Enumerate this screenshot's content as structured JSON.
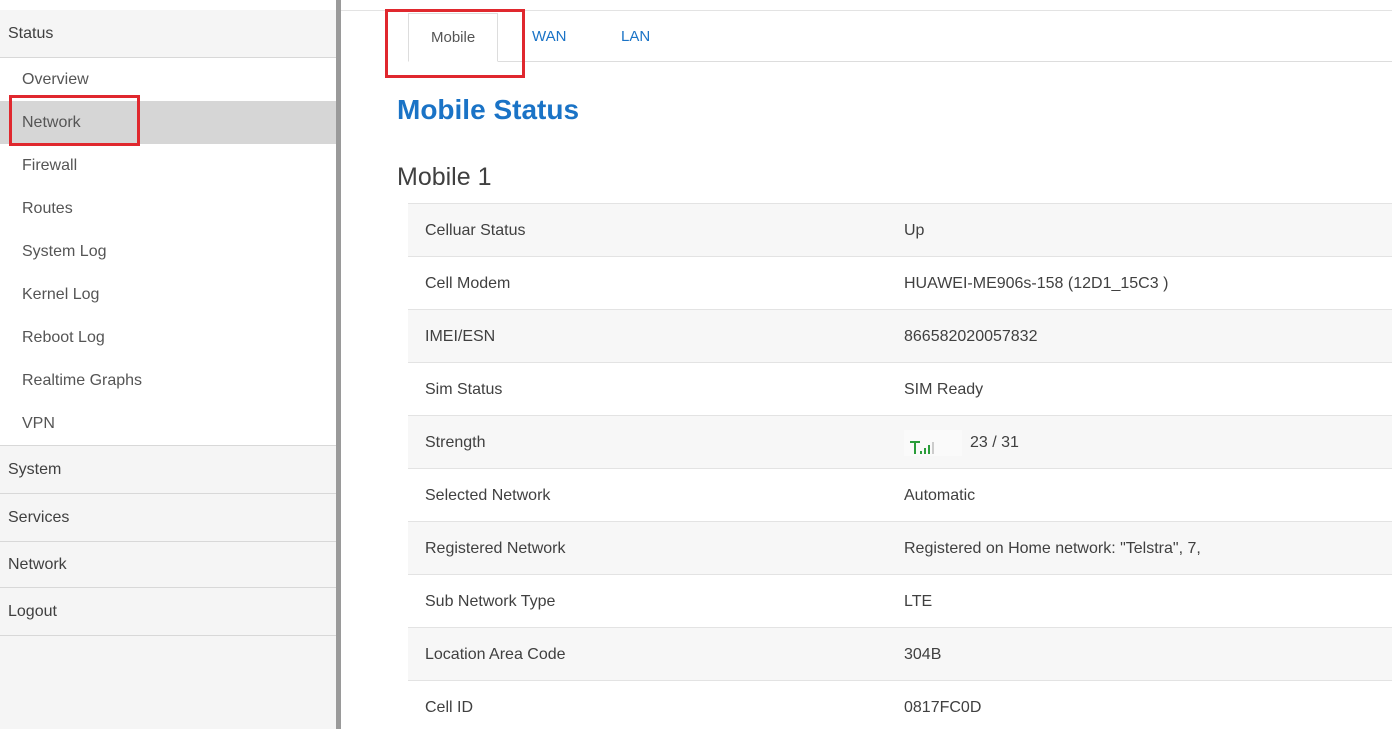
{
  "sidebar": {
    "menu": [
      {
        "label": "Status"
      },
      {
        "label": "System"
      },
      {
        "label": "Services"
      },
      {
        "label": "Network"
      },
      {
        "label": "Logout"
      }
    ],
    "status_submenu": [
      {
        "label": "Overview"
      },
      {
        "label": "Network"
      },
      {
        "label": "Firewall"
      },
      {
        "label": "Routes"
      },
      {
        "label": "System Log"
      },
      {
        "label": "Kernel Log"
      },
      {
        "label": "Reboot Log"
      },
      {
        "label": "Realtime Graphs"
      },
      {
        "label": "VPN"
      }
    ],
    "active_submenu": "Network"
  },
  "tabs": [
    {
      "label": "Mobile",
      "active": true
    },
    {
      "label": "WAN",
      "active": false
    },
    {
      "label": "LAN",
      "active": false
    }
  ],
  "page_title": "Mobile Status",
  "section_title": "Mobile 1",
  "table": [
    {
      "label": "Celluar Status",
      "value": "Up"
    },
    {
      "label": "Cell Modem",
      "value": "HUAWEI-ME906s-158 (12D1_15C3 )"
    },
    {
      "label": "IMEI/ESN",
      "value": "866582020057832"
    },
    {
      "label": "Sim Status",
      "value": "SIM Ready"
    },
    {
      "label": "Strength",
      "value": "23 / 31",
      "icon": "signal-strength-icon"
    },
    {
      "label": "Selected Network",
      "value": "Automatic"
    },
    {
      "label": "Registered Network",
      "value": "Registered on Home network: \"Telstra\", 7,"
    },
    {
      "label": "Sub Network Type",
      "value": "LTE"
    },
    {
      "label": "Location Area Code",
      "value": "304B"
    },
    {
      "label": "Cell ID",
      "value": "0817FC0D"
    }
  ],
  "colors": {
    "accent": "#1a73c6",
    "highlight": "#e0282e",
    "signal": "#2a9d3a"
  }
}
